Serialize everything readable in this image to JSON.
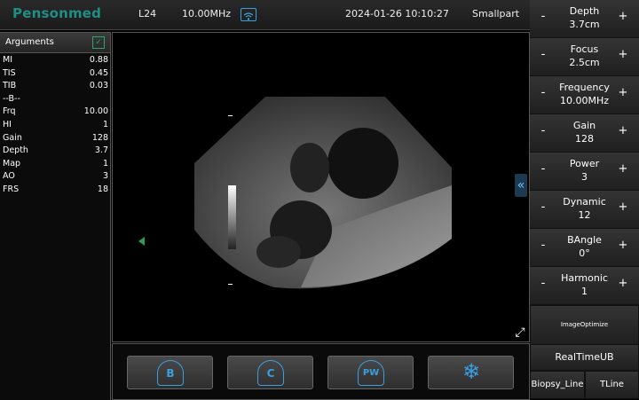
{
  "topbar": {
    "logo": "Pensonmed",
    "probe": "L24",
    "frequency": "10.00MHz",
    "datetime": "2024-01-26 10:10:27",
    "preset": "Smallpart"
  },
  "arguments": {
    "title": "Arguments",
    "check": "✓",
    "rows": [
      {
        "k": "MI",
        "v": "0.88"
      },
      {
        "k": "TIS",
        "v": "0.45"
      },
      {
        "k": "TIB",
        "v": "0.03"
      },
      {
        "k": "--B--",
        "v": ""
      },
      {
        "k": "Frq",
        "v": "10.00"
      },
      {
        "k": "HI",
        "v": "1"
      },
      {
        "k": "Gain",
        "v": "128"
      },
      {
        "k": "Depth",
        "v": "3.7"
      },
      {
        "k": "Map",
        "v": "1"
      },
      {
        "k": "AO",
        "v": "3"
      },
      {
        "k": "FRS",
        "v": "18"
      }
    ]
  },
  "modes": {
    "b": "B",
    "c": "C",
    "pw": "PW",
    "freeze": "❄"
  },
  "icons": {
    "collapse": "«",
    "expand": "⤢"
  },
  "controls": [
    {
      "name": "Depth",
      "value": "3.7cm"
    },
    {
      "name": "Focus",
      "value": "2.5cm"
    },
    {
      "name": "Frequency",
      "value": "10.00MHz"
    },
    {
      "name": "Gain",
      "value": "128"
    },
    {
      "name": "Power",
      "value": "3"
    },
    {
      "name": "Dynamic",
      "value": "12"
    },
    {
      "name": "BAngle",
      "value": "0°"
    },
    {
      "name": "Harmonic",
      "value": "1"
    }
  ],
  "buttons": {
    "minus": "-",
    "plus": "+",
    "image_optimize": "ImageOptimize",
    "realtime_ub": "RealTimeUB",
    "biopsy_line": "Biopsy_Line",
    "tline": "TLine"
  },
  "colors": {
    "accent": "#3a9fe0",
    "logo": "#1f8f86",
    "focus_marker": "#2ea043"
  }
}
